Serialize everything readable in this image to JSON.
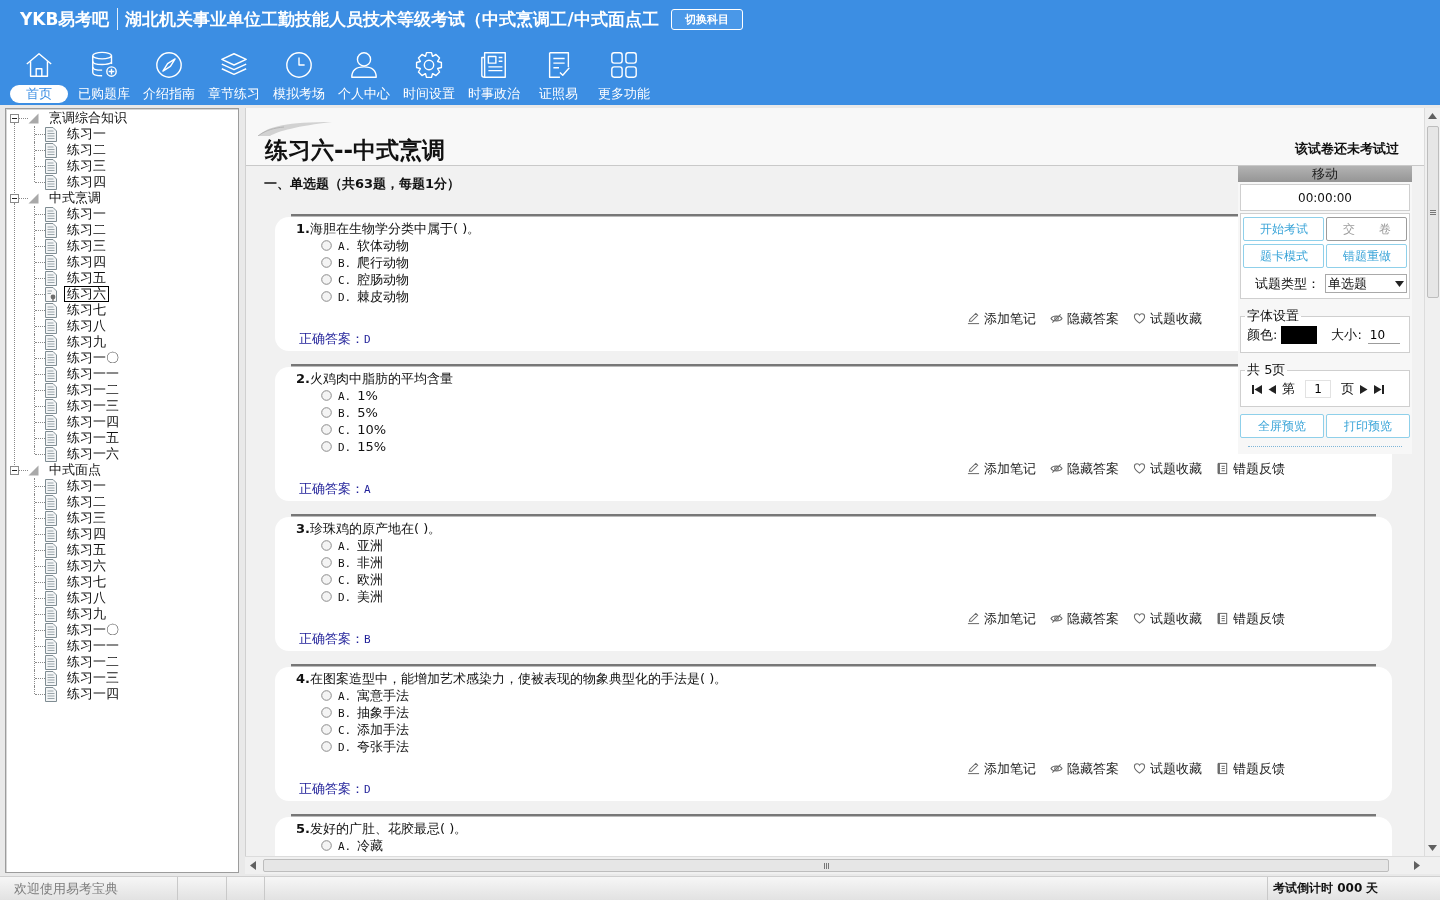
{
  "app": {
    "logo": "YKB易考吧",
    "title": "湖北机关事业单位工勤技能人员技术等级考试（中式烹调工/中式面点工",
    "switch_button": "切换科目"
  },
  "nav": [
    {
      "kind": "home",
      "label": "首页",
      "selected": true
    },
    {
      "kind": "bank",
      "label": "已购题库",
      "selected": false
    },
    {
      "kind": "guide",
      "label": "介绍指南",
      "selected": false
    },
    {
      "kind": "chapter",
      "label": "章节练习",
      "selected": false
    },
    {
      "kind": "mock",
      "label": "模拟考场",
      "selected": false
    },
    {
      "kind": "profile",
      "label": "个人中心",
      "selected": false
    },
    {
      "kind": "settings",
      "label": "时间设置",
      "selected": false
    },
    {
      "kind": "news",
      "label": "时事政治",
      "selected": false
    },
    {
      "kind": "license",
      "label": "证照易",
      "selected": false
    },
    {
      "kind": "more",
      "label": "更多功能",
      "selected": false
    }
  ],
  "tree": [
    {
      "label": "烹调综合知识",
      "expanded": true,
      "selected": false,
      "children": [
        {
          "label": "练习一",
          "selected": false
        },
        {
          "label": "练习二",
          "selected": false
        },
        {
          "label": "练习三",
          "selected": false
        },
        {
          "label": "练习四",
          "selected": false
        }
      ]
    },
    {
      "label": "中式烹调",
      "expanded": true,
      "selected": false,
      "children": [
        {
          "label": "练习一",
          "selected": false
        },
        {
          "label": "练习二",
          "selected": false
        },
        {
          "label": "练习三",
          "selected": false
        },
        {
          "label": "练习四",
          "selected": false
        },
        {
          "label": "练习五",
          "selected": false
        },
        {
          "label": "练习六",
          "selected": true
        },
        {
          "label": "练习七",
          "selected": false
        },
        {
          "label": "练习八",
          "selected": false
        },
        {
          "label": "练习九",
          "selected": false
        },
        {
          "label": "练习一〇",
          "selected": false
        },
        {
          "label": "练习一一",
          "selected": false
        },
        {
          "label": "练习一二",
          "selected": false
        },
        {
          "label": "练习一三",
          "selected": false
        },
        {
          "label": "练习一四",
          "selected": false
        },
        {
          "label": "练习一五",
          "selected": false
        },
        {
          "label": "练习一六",
          "selected": false
        }
      ]
    },
    {
      "label": "中式面点",
      "expanded": true,
      "selected": false,
      "children": [
        {
          "label": "练习一",
          "selected": false
        },
        {
          "label": "练习二",
          "selected": false
        },
        {
          "label": "练习三",
          "selected": false
        },
        {
          "label": "练习四",
          "selected": false
        },
        {
          "label": "练习五",
          "selected": false
        },
        {
          "label": "练习六",
          "selected": false
        },
        {
          "label": "练习七",
          "selected": false
        },
        {
          "label": "练习八",
          "selected": false
        },
        {
          "label": "练习九",
          "selected": false
        },
        {
          "label": "练习一〇",
          "selected": false
        },
        {
          "label": "练习一一",
          "selected": false
        },
        {
          "label": "练习一二",
          "selected": false
        },
        {
          "label": "练习一三",
          "selected": false
        },
        {
          "label": "练习一四",
          "selected": false
        }
      ]
    }
  ],
  "exam": {
    "title": "练习六--中式烹调",
    "status": "该试卷还未考试过",
    "section": "一、单选题（共63题，每题1分）",
    "questions": [
      {
        "number": "1.",
        "text": "海胆在生物学分类中属于( )。",
        "options": [
          {
            "label": "A.",
            "text": "软体动物",
            "selected": false
          },
          {
            "label": "B.",
            "text": "爬行动物",
            "selected": false
          },
          {
            "label": "C.",
            "text": "腔肠动物",
            "selected": false
          },
          {
            "label": "D.",
            "text": "棘皮动物",
            "selected": false
          }
        ],
        "actions": [
          {
            "kind": "note",
            "label": "添加笔记"
          },
          {
            "kind": "hide",
            "label": "隐藏答案"
          },
          {
            "kind": "favorite",
            "label": "试题收藏"
          }
        ],
        "answer_label": "正确答案：",
        "answer": "D"
      },
      {
        "number": "2.",
        "text": "火鸡肉中脂肪的平均含量",
        "options": [
          {
            "label": "A.",
            "text": "1%",
            "selected": false
          },
          {
            "label": "B.",
            "text": "5%",
            "selected": false
          },
          {
            "label": "C.",
            "text": "10%",
            "selected": false
          },
          {
            "label": "D.",
            "text": "15%",
            "selected": false
          }
        ],
        "actions": [
          {
            "kind": "note",
            "label": "添加笔记"
          },
          {
            "kind": "hide",
            "label": "隐藏答案"
          },
          {
            "kind": "favorite",
            "label": "试题收藏"
          },
          {
            "kind": "feedback",
            "label": "错题反馈"
          }
        ],
        "answer_label": "正确答案：",
        "answer": "A"
      },
      {
        "number": "3.",
        "text": "珍珠鸡的原产地在( )。",
        "options": [
          {
            "label": "A.",
            "text": "亚洲",
            "selected": false
          },
          {
            "label": "B.",
            "text": "非洲",
            "selected": false
          },
          {
            "label": "C.",
            "text": "欧洲",
            "selected": false
          },
          {
            "label": "D.",
            "text": "美洲",
            "selected": false
          }
        ],
        "actions": [
          {
            "kind": "note",
            "label": "添加笔记"
          },
          {
            "kind": "hide",
            "label": "隐藏答案"
          },
          {
            "kind": "favorite",
            "label": "试题收藏"
          },
          {
            "kind": "feedback",
            "label": "错题反馈"
          }
        ],
        "answer_label": "正确答案：",
        "answer": "B"
      },
      {
        "number": "4.",
        "text": "在图案造型中，能增加艺术感染力，使被表现的物象典型化的手法是( )。",
        "options": [
          {
            "label": "A.",
            "text": "寓意手法",
            "selected": false
          },
          {
            "label": "B.",
            "text": "抽象手法",
            "selected": false
          },
          {
            "label": "C.",
            "text": "添加手法",
            "selected": false
          },
          {
            "label": "D.",
            "text": "夸张手法",
            "selected": false
          }
        ],
        "actions": [
          {
            "kind": "note",
            "label": "添加笔记"
          },
          {
            "kind": "hide",
            "label": "隐藏答案"
          },
          {
            "kind": "favorite",
            "label": "试题收藏"
          },
          {
            "kind": "feedback",
            "label": "错题反馈"
          }
        ],
        "answer_label": "正确答案：",
        "answer": "D"
      },
      {
        "number": "5.",
        "text": "发好的广肚、花胶最忌( )。",
        "options": [
          {
            "label": "A.",
            "text": "冷藏",
            "selected": false
          }
        ]
      }
    ]
  },
  "panel": {
    "handle": "移动",
    "timer": "00:00:00",
    "buttons": [
      {
        "label": "开始考试",
        "disabled": false
      },
      {
        "label": "交　　卷",
        "disabled": true
      },
      {
        "label": "题卡模式",
        "disabled": false
      },
      {
        "label": "错题重做",
        "disabled": false
      }
    ],
    "question_type": {
      "label": "试题类型：",
      "value": "单选题"
    },
    "font_settings": {
      "legend": "字体设置",
      "color_label": "颜色:",
      "color": "#000000",
      "size_label": "大小:",
      "size": "10"
    },
    "pager": {
      "legend": "共 5页",
      "prefix": "第",
      "page": "1",
      "suffix": "页"
    },
    "preview_buttons": [
      {
        "label": "全屏预览",
        "disabled": false
      },
      {
        "label": "打印预览",
        "disabled": false
      }
    ]
  },
  "status_bar": {
    "welcome": "欢迎使用易考宝典",
    "countdown": "考试倒计时 000 天"
  }
}
